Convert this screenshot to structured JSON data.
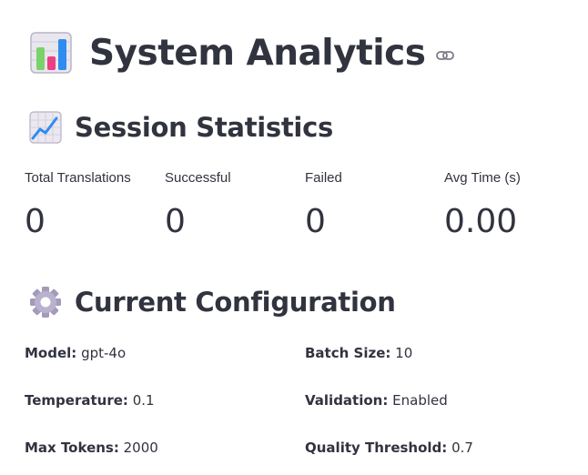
{
  "page": {
    "title": "System Analytics",
    "title_icon": "bar-chart-icon",
    "link_icon": "link-icon"
  },
  "session_statistics": {
    "heading": "Session Statistics",
    "icon": "line-chart-icon",
    "metrics": [
      {
        "label": "Total Translations",
        "value": "0"
      },
      {
        "label": "Successful",
        "value": "0"
      },
      {
        "label": "Failed",
        "value": "0"
      },
      {
        "label": "Avg Time (s)",
        "value": "0.00"
      }
    ]
  },
  "current_configuration": {
    "heading": "Current Configuration",
    "icon": "gear-icon",
    "items": [
      {
        "key": "Model:",
        "value": "gpt-4o"
      },
      {
        "key": "Batch Size:",
        "value": "10"
      },
      {
        "key": "Temperature:",
        "value": "0.1"
      },
      {
        "key": "Validation:",
        "value": "Enabled"
      },
      {
        "key": "Max Tokens:",
        "value": "2000"
      },
      {
        "key": "Quality Threshold:",
        "value": "0.7"
      }
    ]
  }
}
